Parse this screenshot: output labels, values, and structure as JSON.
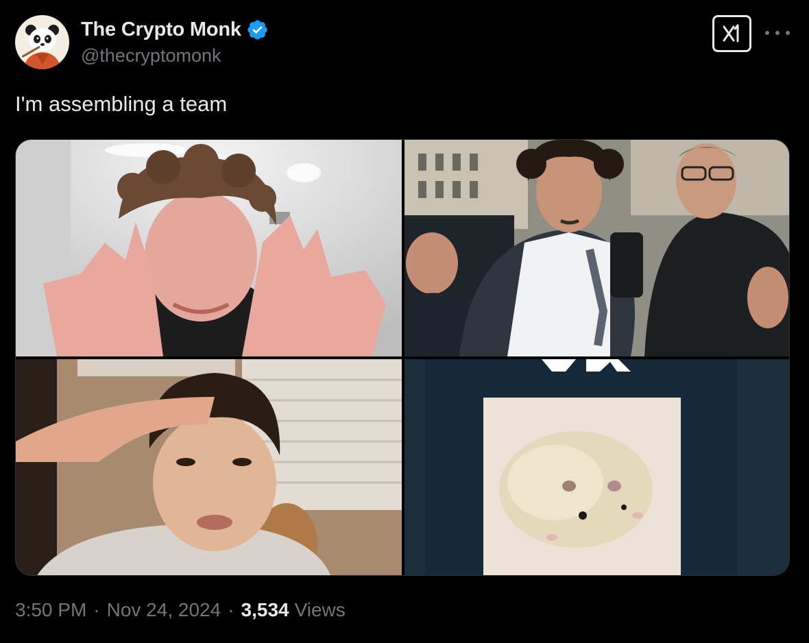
{
  "author": {
    "display_name": "The Crypto Monk",
    "handle": "@thecryptomonk",
    "verified": true,
    "avatar_icon": "panda-monk-avatar"
  },
  "header_actions": {
    "grok_icon": "grok-icon",
    "more_icon": "more-dots-icon"
  },
  "tweet": {
    "text": "I'm assembling a team"
  },
  "media": {
    "tiles": [
      {
        "name": "photo-curly-hair-young-man-gesturing"
      },
      {
        "name": "photo-man-in-crowd-with-bodyguard"
      },
      {
        "name": "photo-man-saluting"
      },
      {
        "name": "photo-hamster",
        "partial_text": "OK"
      }
    ]
  },
  "meta": {
    "time": "3:50 PM",
    "date": "Nov 24, 2024",
    "separator": "·",
    "views_count": "3,534",
    "views_label": "Views"
  },
  "colors": {
    "background": "#000000",
    "primary_text": "#e7e9ea",
    "secondary_text": "#71767b",
    "verified_badge": "#1d9bf0"
  }
}
